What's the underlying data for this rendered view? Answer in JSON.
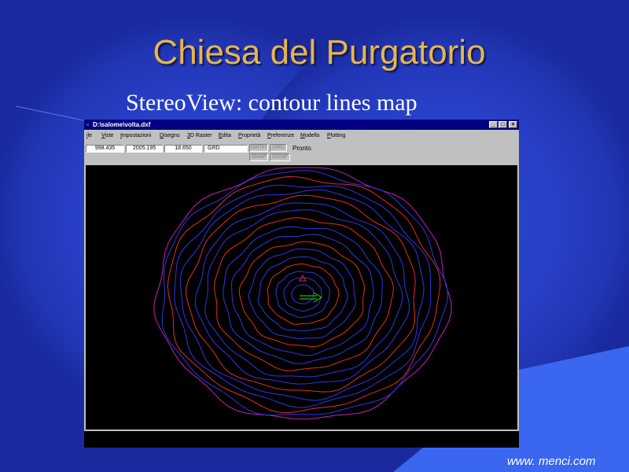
{
  "slide": {
    "title": "Chiesa del Purgatorio",
    "subtitle": "StereoView: contour lines map",
    "footer_url": "www. menci.com"
  },
  "window": {
    "title": "D:\\salome\\volta.dxf",
    "controls": {
      "minimize": "_",
      "maximize": "□",
      "close": "×"
    }
  },
  "menu": [
    "ile",
    "Viste",
    "Impostazioni",
    "Disegno",
    "3D Raster",
    "Edita",
    "Proprietà",
    "Preferenze",
    "Modello",
    "Plotting"
  ],
  "status": {
    "x": "998.435",
    "y": "2005.195",
    "z": "18.650",
    "grid": "GRD",
    "modes": [
      "ORTH",
      "GRD",
      "SNAP",
      "OSNP"
    ],
    "message": "Pronto."
  },
  "colors": {
    "background": "#1a2a9e",
    "title": "#e6b64a",
    "contour_primary": "#3434e8",
    "contour_secondary": "#e03020",
    "contour_accent": "#c020c0",
    "arrow": "#20e020"
  }
}
